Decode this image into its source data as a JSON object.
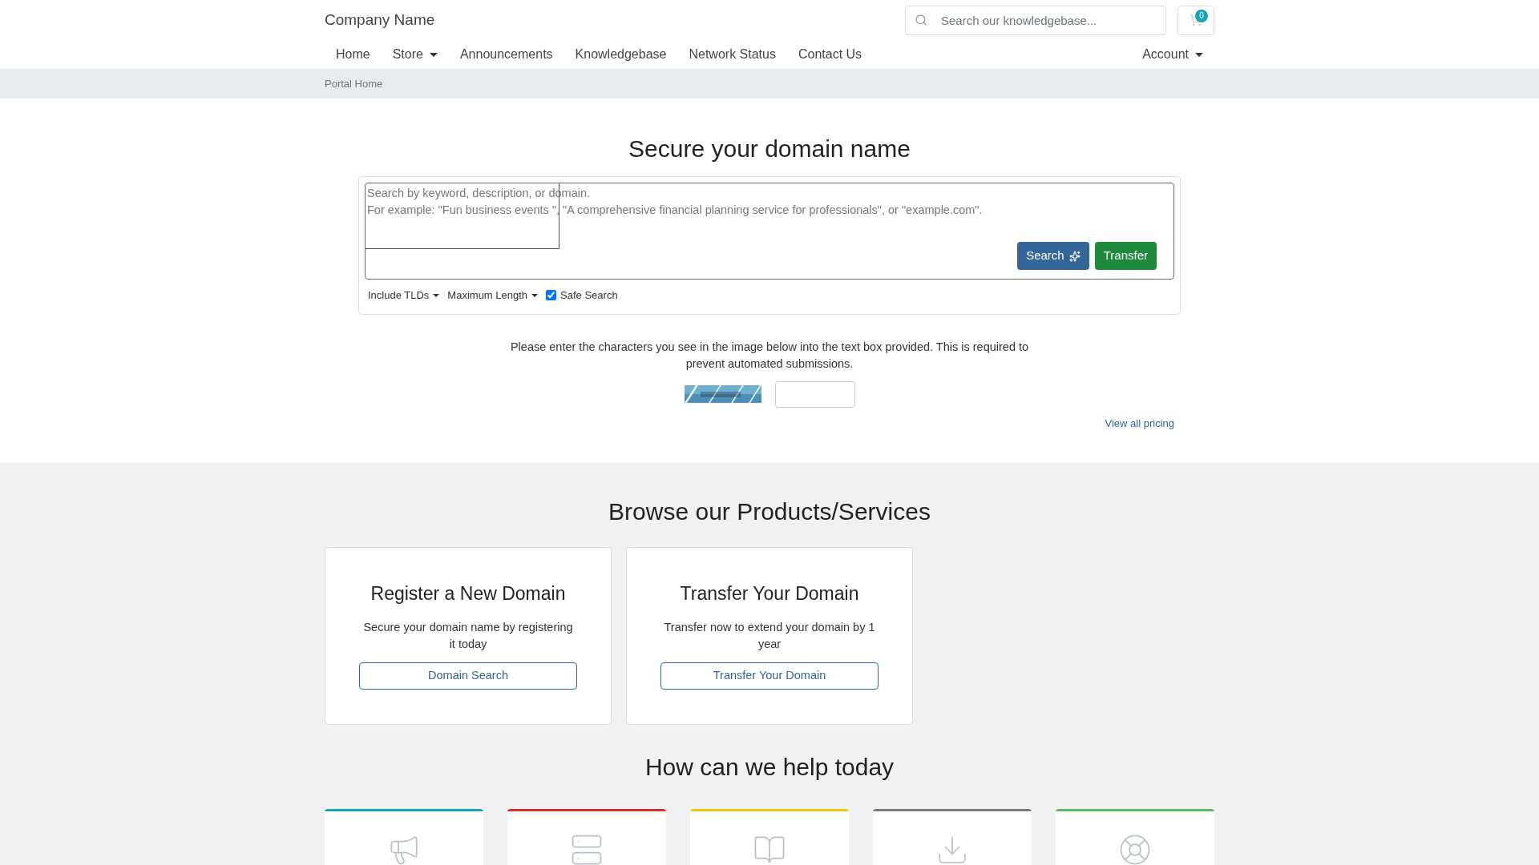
{
  "header": {
    "brand": "Company Name",
    "search": {
      "placeholder": "Search our knowledgebase..."
    },
    "cart_count": "0"
  },
  "nav": {
    "items": [
      {
        "label": "Home",
        "dropdown": false
      },
      {
        "label": "Store",
        "dropdown": true
      },
      {
        "label": "Announcements",
        "dropdown": false
      },
      {
        "label": "Knowledgebase",
        "dropdown": false
      },
      {
        "label": "Network Status",
        "dropdown": false
      },
      {
        "label": "Contact Us",
        "dropdown": false
      }
    ],
    "account": {
      "label": "Account",
      "dropdown": true
    }
  },
  "breadcrumb": [
    "Portal Home"
  ],
  "domain_search": {
    "title": "Secure your domain name",
    "placeholder": "Search by keyword, description, or domain.\nFor example: \"Fun business events \", \"A comprehensive financial planning service for professionals\", or \"example.com\".",
    "buttons": [
      {
        "label": "Search",
        "kind": "search"
      },
      {
        "label": "Transfer",
        "kind": "transfer"
      }
    ],
    "options": [
      {
        "label": "Include TLDs",
        "kind": "dropdown"
      },
      {
        "label": "Maximum Length",
        "kind": "dropdown"
      },
      {
        "label": "Safe Search",
        "kind": "checkbox",
        "checked": true
      }
    ]
  },
  "captcha": {
    "instructions": "Please enter the characters you see in the image below into the text box provided. This is required to prevent automated submissions."
  },
  "pricing_link": "View all pricing",
  "products": {
    "title": "Browse our Products/Services",
    "cards": [
      {
        "title": "Register a New Domain",
        "text": "Secure your domain name by registering it today",
        "button": "Domain Search"
      },
      {
        "title": "Transfer Your Domain",
        "text": "Transfer now to extend your domain by 1 year",
        "button": "Transfer Your Domain"
      }
    ]
  },
  "help": {
    "title": "How can we help today",
    "tiles": [
      {
        "color": "#17a2b8"
      },
      {
        "color": "#d9302c"
      },
      {
        "color": "#f0c30f"
      },
      {
        "color": "#7a7d80"
      },
      {
        "color": "#5cb85c"
      }
    ]
  }
}
